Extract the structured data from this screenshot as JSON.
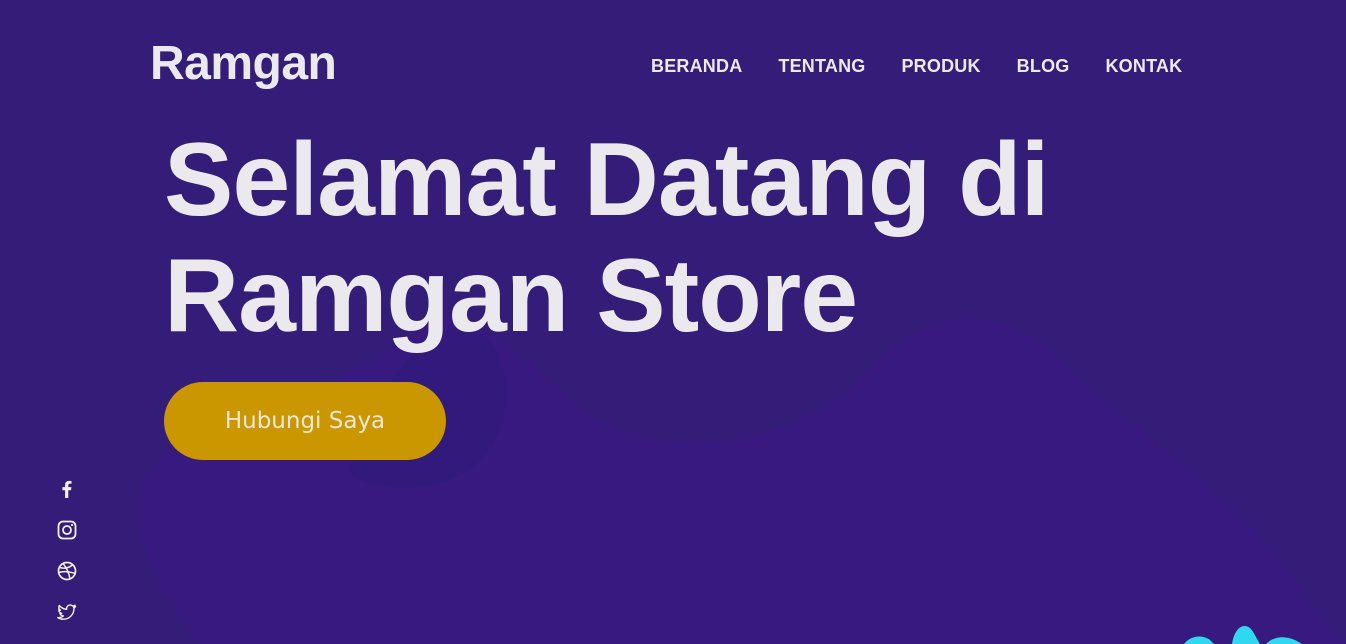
{
  "brand": {
    "name": "Ramgan"
  },
  "nav": {
    "items": [
      {
        "label": "BERANDA"
      },
      {
        "label": "TENTANG"
      },
      {
        "label": "PRODUK"
      },
      {
        "label": "BLOG"
      },
      {
        "label": "KONTAK"
      }
    ]
  },
  "hero": {
    "title_line1": "Selamat Datang di",
    "title_line2": "Ramgan Store",
    "cta_label": "Hubungi Saya"
  },
  "social": {
    "icons": [
      "facebook-icon",
      "instagram-icon",
      "dribbble-icon",
      "twitter-icon"
    ]
  },
  "colors": {
    "background": "#341c79",
    "background_blob": "#371a80",
    "text": "#ece9ee",
    "cta": "#ca9700",
    "accent_decoration": "#2fd8f0"
  }
}
